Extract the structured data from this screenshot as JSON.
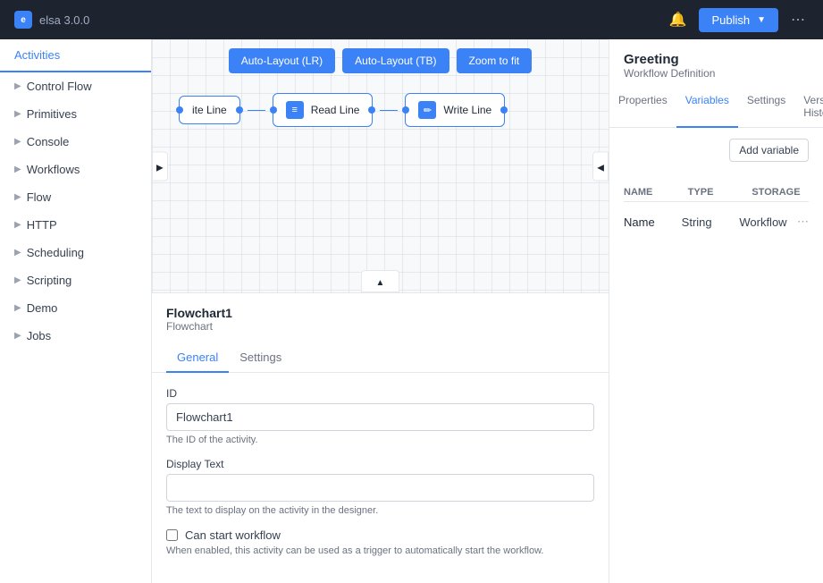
{
  "app": {
    "name": "elsa 3.0.0"
  },
  "topbar": {
    "logo_text": "elsa 3.0.0",
    "bell_icon": "🔔",
    "publish_label": "Publish",
    "more_icon": "⋯"
  },
  "sidebar": {
    "active_tab": "Activities",
    "items": [
      {
        "label": "Control Flow"
      },
      {
        "label": "Primitives"
      },
      {
        "label": "Console"
      },
      {
        "label": "Workflows"
      },
      {
        "label": "Flow"
      },
      {
        "label": "HTTP"
      },
      {
        "label": "Scheduling"
      },
      {
        "label": "Scripting"
      },
      {
        "label": "Demo"
      },
      {
        "label": "Jobs"
      }
    ]
  },
  "canvas": {
    "toolbar": {
      "auto_layout_lr": "Auto-Layout (LR)",
      "auto_layout_tb": "Auto-Layout (TB)",
      "zoom_to_fit": "Zoom to fit"
    },
    "nodes": [
      {
        "label": "Write Line",
        "type": "write"
      },
      {
        "label": "Read Line",
        "type": "read"
      },
      {
        "label": "Write Line",
        "type": "write"
      }
    ]
  },
  "bottom_panel": {
    "title": "Flowchart1",
    "subtitle": "Flowchart",
    "tabs": [
      "General",
      "Settings"
    ],
    "active_tab": "General",
    "id_label": "ID",
    "id_value": "Flowchart1",
    "id_hint": "The ID of the activity.",
    "display_text_label": "Display Text",
    "display_text_value": "",
    "display_text_placeholder": "",
    "display_text_hint": "The text to display on the activity in the designer.",
    "can_start_label": "Can start workflow",
    "can_start_hint": "When enabled, this activity can be used as a trigger to automatically start the workflow."
  },
  "right_panel": {
    "title": "Greeting",
    "subtitle": "Workflow Definition",
    "tabs": [
      "Properties",
      "Variables",
      "Settings",
      "Version History"
    ],
    "active_tab": "Variables",
    "add_variable_label": "Add variable",
    "table_headers": {
      "name": "NAME",
      "type": "TYPE",
      "storage": "STORAGE"
    },
    "variables": [
      {
        "name": "Name",
        "type": "String",
        "storage": "Workflow"
      }
    ]
  }
}
